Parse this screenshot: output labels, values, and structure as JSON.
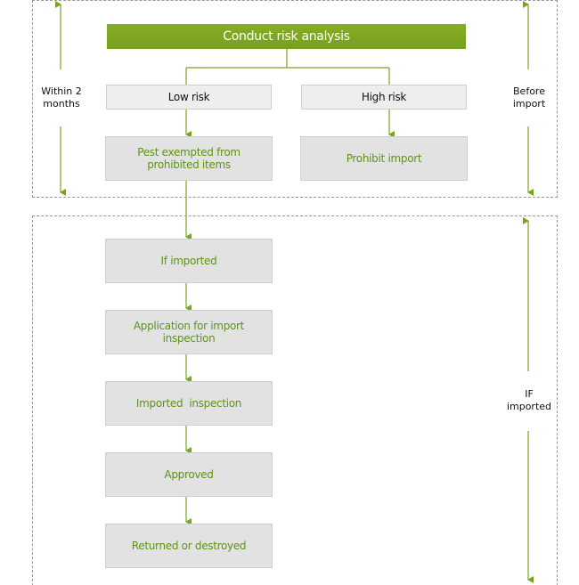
{
  "colors": {
    "accent": "#7aa41f",
    "box_fill": "#e2e2e2",
    "label_fill": "#eeeeee",
    "step_text": "#5e9416"
  },
  "header": {
    "title": "Conduct risk analysis"
  },
  "branches": {
    "low": "Low risk",
    "high": "High risk"
  },
  "outcomes": {
    "low": "Pest exempted from prohibited items",
    "high": "Prohibit import"
  },
  "steps": [
    "If imported",
    "Application for import inspection",
    "Imported  inspection",
    "Approved",
    "Returned or destroyed"
  ],
  "side_labels": {
    "top_left": "Within 2 months",
    "top_right": "Before import",
    "bottom_right": "IF imported"
  }
}
